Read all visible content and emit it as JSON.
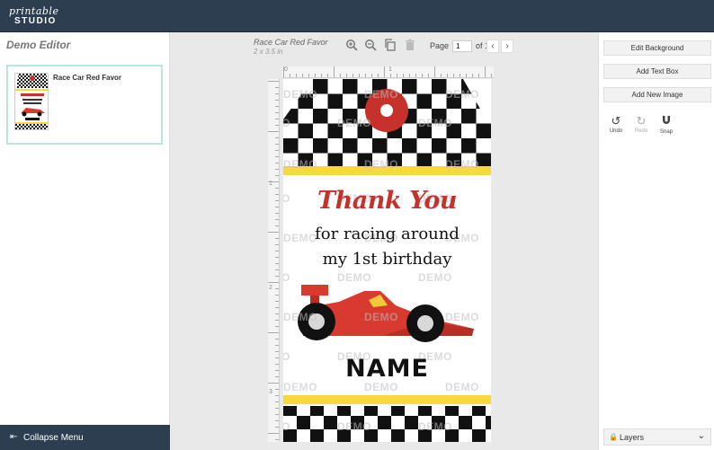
{
  "app": {
    "logo_top": "printable",
    "logo_bottom": "STUDIO"
  },
  "sidebar": {
    "title": "Demo Editor",
    "item_name": "Race Car Red Favor",
    "collapse_label": "Collapse Menu"
  },
  "toolbar": {
    "doc_name": "Race Car Red Favor",
    "doc_size": "2 x 3.5 in",
    "page_label": "Page",
    "page_value": "1",
    "page_of": "of 1"
  },
  "ruler": {
    "h_labels": [
      "0",
      "1"
    ],
    "v_labels": [
      "1",
      "2",
      "3"
    ]
  },
  "canvas": {
    "watermark": "DEMO",
    "thank_you": "Thank You",
    "line1": "for racing around",
    "line2": "my 1st birthday",
    "name": "NAME"
  },
  "right_panel": {
    "edit_background": "Edit Background",
    "add_text_box": "Add Text Box",
    "add_new_image": "Add New Image",
    "undo": "Undo",
    "redo": "Redo",
    "snap": "Snap",
    "layers": "Layers"
  },
  "colors": {
    "topbar": "#2d3e50",
    "accent_red": "#c6312b",
    "stripe_yellow": "#f7d93d",
    "card_border": "#bfe3df"
  }
}
